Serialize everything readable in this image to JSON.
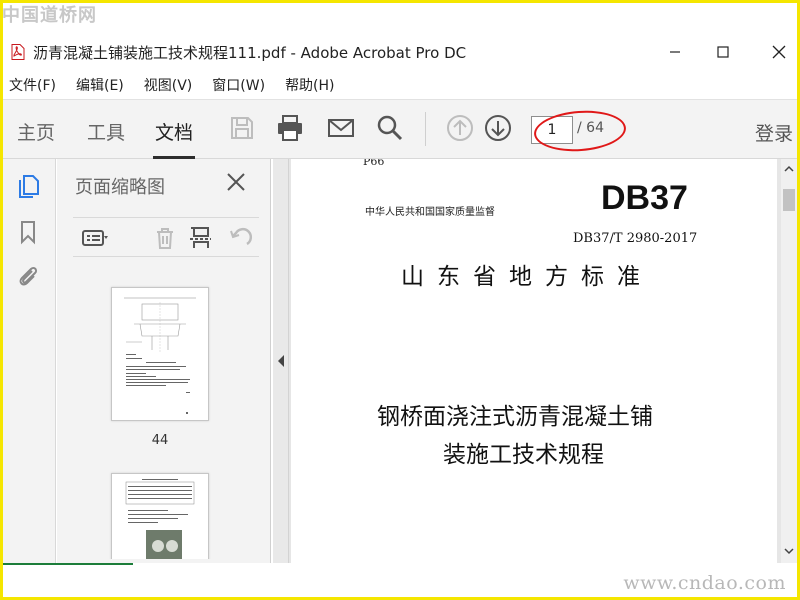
{
  "watermark": {
    "top": "中国道桥网",
    "bottom": "www.cndao.com"
  },
  "window": {
    "title": "沥青混凝土铺装施工技术规程111.pdf - Adobe Acrobat Pro DC",
    "file_icon": "pdf-file-icon"
  },
  "menu": {
    "items": [
      {
        "label": "文件(F)"
      },
      {
        "label": "编辑(E)"
      },
      {
        "label": "视图(V)"
      },
      {
        "label": "窗口(W)"
      },
      {
        "label": "帮助(H)"
      }
    ]
  },
  "toolbar": {
    "tabs": [
      {
        "label": "主页"
      },
      {
        "label": "工具"
      },
      {
        "label": "文档",
        "active": true
      }
    ],
    "page_current": "1",
    "page_total": "/ 64",
    "login": "登录",
    "icons": [
      "save-icon",
      "print-icon",
      "email-icon",
      "search-icon",
      "prev-page-icon",
      "next-page-icon"
    ],
    "annotation_color": "#e01818"
  },
  "panel": {
    "title": "页面缩略图",
    "thumbnails": [
      {
        "label": "44"
      }
    ]
  },
  "document": {
    "page_marker": "P66",
    "authority": "中华人民共和国国家质量监督",
    "code": "DB37",
    "standard_no": "DB37/T 2980-2017",
    "province_title": "山东省地方标准",
    "title_line1": "钢桥面浇注式沥青混凝土铺",
    "title_line2": "装施工技术规程"
  },
  "colors": {
    "frame": "#f5e600",
    "toolbar_bg": "#f3f3f3",
    "accent": "#2d7be5"
  }
}
